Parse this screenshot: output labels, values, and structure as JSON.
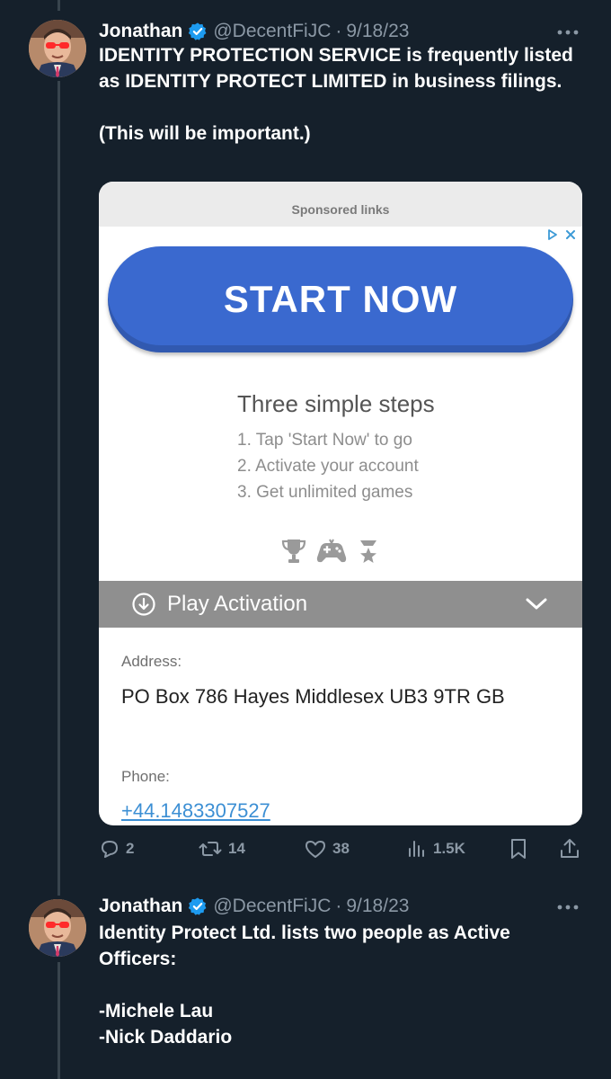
{
  "colors": {
    "background": "#15202b",
    "secondary_text": "#8b98a5",
    "verified": "#1d9bf0",
    "cta_button": "#3a69cf",
    "link": "#3c8fd4"
  },
  "tweets": [
    {
      "author_name": "Jonathan",
      "handle": "@DecentFiJC",
      "separator": "·",
      "date": "9/18/23",
      "more_icon": "ellipsis-icon",
      "text": "IDENTITY PROTECTION SERVICE is frequently listed as IDENTITY PROTECT LIMITED in business filings.\n\n(This will be important.)",
      "stats": {
        "replies": "2",
        "retweets": "14",
        "likes": "38",
        "views": "1.5K"
      }
    },
    {
      "author_name": "Jonathan",
      "handle": "@DecentFiJC",
      "separator": "·",
      "date": "9/18/23",
      "more_icon": "ellipsis-icon",
      "text": "Identity Protect Ltd. lists two people as Active Officers:\n\n-Michele Lau\n-Nick Daddario"
    }
  ],
  "ad_card": {
    "sponsor_label": "Sponsored links",
    "cta_label": "START NOW",
    "steps_title": "Three simple steps",
    "steps": [
      "1. Tap 'Start Now' to go",
      "2. Activate your account",
      "3. Get unlimited games"
    ],
    "play_bar_label": "Play Activation",
    "address_label": "Address:",
    "address_value": "PO Box 786 Hayes Middlesex UB3 9TR GB",
    "phone_label": "Phone:",
    "phone_value": "+44.1483307527"
  }
}
